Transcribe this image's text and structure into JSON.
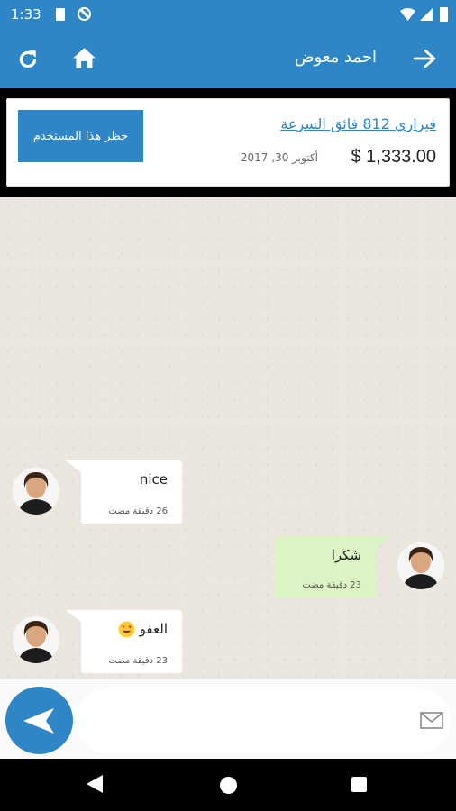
{
  "status_bar": {
    "time": "1:33",
    "icons": [
      "sim-card-icon",
      "do-not-disturb-icon",
      "wifi-icon",
      "signal-icon",
      "battery-icon"
    ]
  },
  "app_bar": {
    "title": "احمد معوض",
    "icons": [
      "refresh-icon",
      "home-icon",
      "back-arrow-icon"
    ]
  },
  "ad": {
    "title": "فيراري 812 فائق السرعة",
    "price": "$ 1,333.00",
    "date": "أكتوبر 30, 2017",
    "block_button": "حظر هذا المستخدم"
  },
  "messages": [
    {
      "sender": "them",
      "text": "nice",
      "time": "26 دقيقة مضت"
    },
    {
      "sender": "me",
      "text": "شكرا",
      "time": "23 دقيقة مضت"
    },
    {
      "sender": "them",
      "text": "العفو",
      "time": "23 دقيقة مضت",
      "emoji": "heart-eyes-emoji"
    }
  ],
  "composer": {
    "value": "",
    "placeholder": ""
  },
  "colors": {
    "primary": "#2f86c7",
    "outgoing_bubble": "#dcf3c4",
    "incoming_bubble": "#ffffff",
    "chat_background": "#ebe7df"
  }
}
